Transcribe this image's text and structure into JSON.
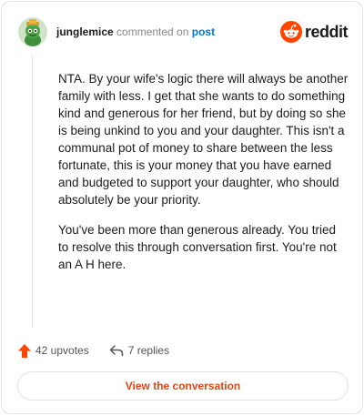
{
  "comment": {
    "author": "junglemice",
    "action_text": "commented on",
    "post_link": "post",
    "avatar_icon": "snoo-avatar-icon",
    "paragraphs": [
      "NTA. By your wife's logic there will always be another family with less. I get that she wants to do something kind and generous for her friend, but by doing so she is being unkind to you and your daughter. This isn't a communal pot of money to share between the less fortunate, this is your money that you have earned and budgeted to support your daughter, who should absolutely be your priority.",
      "You've been more than generous already. You tried to resolve this through conversation first. You're not an A H here."
    ]
  },
  "brand": {
    "name": "reddit",
    "icon": "reddit-logo-icon",
    "color": "#ff4500"
  },
  "actions": {
    "upvotes": "42 upvotes",
    "replies": "7 replies"
  },
  "cta": {
    "label": "View the conversation",
    "color": "#e04616"
  }
}
